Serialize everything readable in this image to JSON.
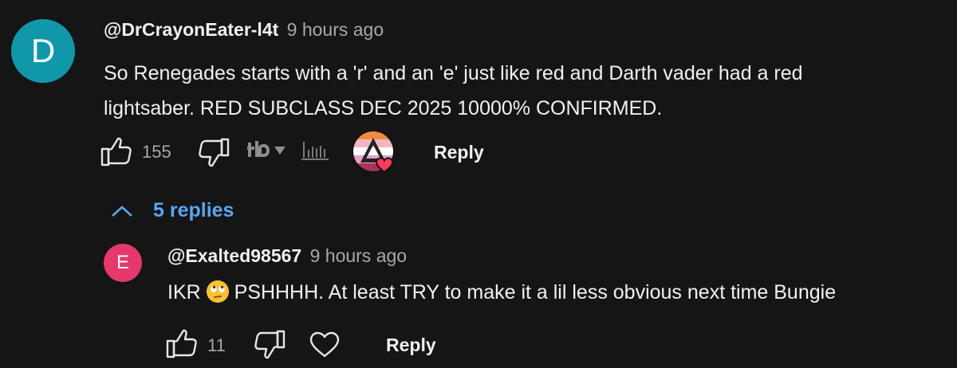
{
  "comment": {
    "avatar_letter": "D",
    "avatar_color": "#1098a8",
    "handle": "@DrCrayonEater-l4t",
    "time": "9 hours ago",
    "text_line1": "So Renegades starts with a 'r' and an 'e' just like red and Darth vader had a red",
    "text_line2": "lightsaber. RED SUBCLASS DEC 2025 10000% CONFIRMED.",
    "likes": "155",
    "reply_label": "Reply"
  },
  "replies_toggle": {
    "label": "5 replies"
  },
  "reply": {
    "avatar_letter": "E",
    "avatar_color": "#e5386d",
    "handle": "@Exalted98567",
    "time": "9 hours ago",
    "text_before": "IKR",
    "emoji": "🙄",
    "text_after": "PSHHHH.  At least TRY to make it a lil less obvious next time Bungie",
    "likes": "11",
    "reply_label": "Reply"
  },
  "icons": {
    "like": "thumbs-up-icon",
    "dislike": "thumbs-down-icon",
    "extension": "tb-extension-icon",
    "dropdown": "dropdown-arrow-icon",
    "stats": "bar-stats-icon",
    "creator_heart": "creator-heart-avatar-icon",
    "heart": "heart-icon",
    "collapse": "chevron-up-icon"
  },
  "colors": {
    "background": "#151515",
    "link": "#5aa6f2",
    "muted": "#a8a8a8",
    "heart_red": "#ff3b5c"
  }
}
